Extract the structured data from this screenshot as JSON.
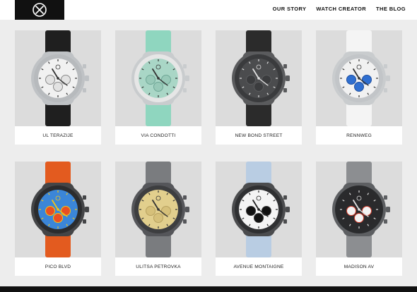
{
  "brand": {
    "logo_icon": "x-circle-logo-icon"
  },
  "nav": {
    "items": [
      {
        "label": "OUR STORY"
      },
      {
        "label": "WATCH CREATOR"
      },
      {
        "label": "THE BLOG"
      }
    ]
  },
  "watches": [
    {
      "name": "UL TERAZIJE",
      "dial": "#f1f1f1",
      "sub": "#e2e2e2",
      "subring": "#8a8a8a",
      "strap": "#1f1f1f",
      "case": "#bfc2c5",
      "bezel": "#b7babd",
      "bg": "#dcdcdc",
      "hands": "#333333"
    },
    {
      "name": "VIA CONDOTTI",
      "dial": "#a9d6c6",
      "sub": "#98c9b8",
      "subring": "#6fa796",
      "strap": "#8fd6bf",
      "case": "#c9ccce",
      "bezel": "#e6e6e6",
      "bg": "#dcdcdc",
      "hands": "#333333"
    },
    {
      "name": "NEW BOND STREET",
      "dial": "#4b4c4e",
      "sub": "#3b3c3e",
      "subring": "#5a5b5d",
      "strap": "#2b2b2b",
      "case": "#5a5b5d",
      "bezel": "#3a3b3d",
      "bg": "#dcdcdc",
      "hands": "#e0e0e0"
    },
    {
      "name": "RENNWEG",
      "dial": "#f1f1f1",
      "sub": "#2f6fd0",
      "subring": "#1e4fa0",
      "strap": "#f4f4f4",
      "case": "#c9ccce",
      "bezel": "#c2c5c8",
      "bg": "#dcdcdc",
      "hands": "#333333"
    },
    {
      "name": "PICO BLVD",
      "dial": "#3b86d8",
      "sub": "#e94f22",
      "subring": "#f2c418",
      "strap": "#e35b1f",
      "case": "#444547",
      "bezel": "#2b2c2e",
      "bg": "#dcdcdc",
      "hands": "#f2c418"
    },
    {
      "name": "ULITSA PETROVKA",
      "dial": "#e2cf8d",
      "sub": "#d6c07a",
      "subring": "#b8a260",
      "strap": "#7a7c7f",
      "case": "#55565a",
      "bezel": "#3d3e40",
      "bg": "#dcdcdc",
      "hands": "#333333"
    },
    {
      "name": "AVENUE MONTAIGNE",
      "dial": "#f4f4f4",
      "sub": "#111111",
      "subring": "#333333",
      "strap": "#b9cde3",
      "case": "#4b4c4e",
      "bezel": "#2f3032",
      "bg": "#dcdcdc",
      "hands": "#222222"
    },
    {
      "name": "MADISON AV",
      "dial": "#2a2a2c",
      "sub": "#f2f2f2",
      "subring": "#d23b2a",
      "strap": "#8c8e91",
      "case": "#5d5f62",
      "bezel": "#2a2b2d",
      "bg": "#dcdcdc",
      "hands": "#e0e0e0"
    }
  ]
}
